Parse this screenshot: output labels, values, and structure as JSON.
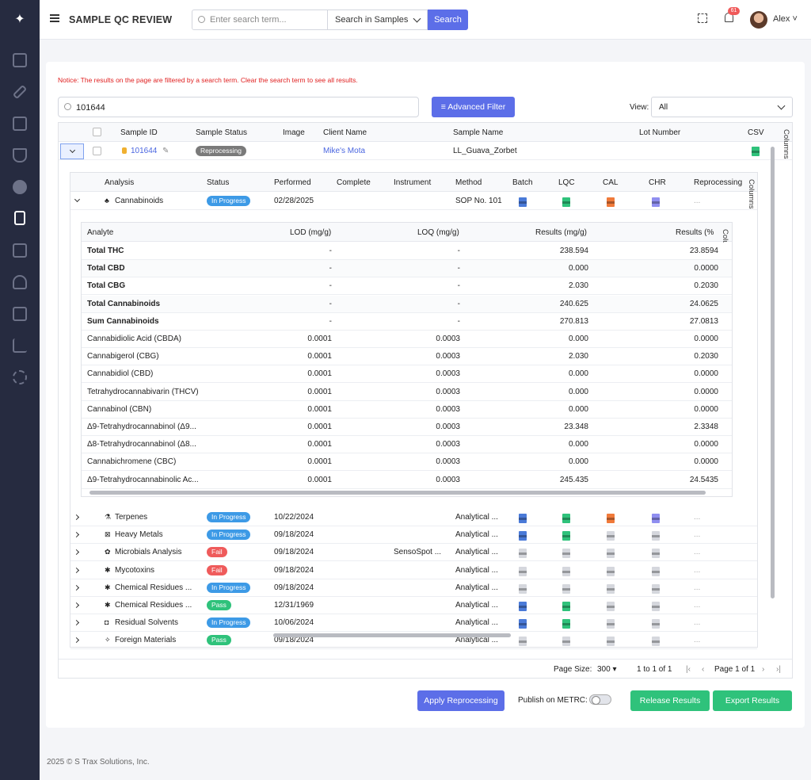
{
  "app": {
    "title": "SAMPLE QC REVIEW",
    "user": "Alex",
    "notifications": "61"
  },
  "topsearch": {
    "placeholder": "Enter search term...",
    "scope": "Search in Samples",
    "button": "Search"
  },
  "notice": "Notice: The results on the page are filtered by a search term. Clear the search term to see all results.",
  "filter": {
    "search_value": "101644",
    "advanced": "Advanced Filter",
    "view_label": "View:",
    "view_value": "All"
  },
  "main_cols": [
    "Sample ID",
    "Sample Status",
    "Image",
    "Client Name",
    "Sample Name",
    "Lot Number",
    "CSV"
  ],
  "sample": {
    "id": "101644",
    "status": "Reprocessing",
    "client": "Mike's Mota",
    "name": "LL_Guava_Zorbet"
  },
  "columns_label": "Columns",
  "analysis_cols": [
    "Analysis",
    "Status",
    "Performed",
    "Complete",
    "Instrument",
    "Method",
    "Batch",
    "LQC",
    "CAL",
    "CHR",
    "Reprocessing"
  ],
  "cannabinoids": {
    "name": "Cannabinoids",
    "status": "In Progress",
    "performed": "02/28/2025",
    "method": "SOP No. 101",
    "reprocessing": "..."
  },
  "analyte_cols": [
    "Analyte",
    "LOD (mg/g)",
    "LOQ (mg/g)",
    "Results (mg/g)",
    "Results (%"
  ],
  "analytes": [
    {
      "name": "Total THC",
      "lod": "-",
      "loq": "-",
      "res": "238.594",
      "pct": "23.8594",
      "bold": true
    },
    {
      "name": "Total CBD",
      "lod": "-",
      "loq": "-",
      "res": "0.000",
      "pct": "0.0000",
      "bold": true
    },
    {
      "name": "Total CBG",
      "lod": "-",
      "loq": "-",
      "res": "2.030",
      "pct": "0.2030",
      "bold": true
    },
    {
      "name": "Total Cannabinoids",
      "lod": "-",
      "loq": "-",
      "res": "240.625",
      "pct": "24.0625",
      "bold": true
    },
    {
      "name": "Sum Cannabinoids",
      "lod": "-",
      "loq": "-",
      "res": "270.813",
      "pct": "27.0813",
      "bold": true
    },
    {
      "name": "Cannabidiolic Acid (CBDA)",
      "lod": "0.0001",
      "loq": "0.0003",
      "res": "0.000",
      "pct": "0.0000",
      "bold": false
    },
    {
      "name": "Cannabigerol (CBG)",
      "lod": "0.0001",
      "loq": "0.0003",
      "res": "2.030",
      "pct": "0.2030",
      "bold": false
    },
    {
      "name": "Cannabidiol (CBD)",
      "lod": "0.0001",
      "loq": "0.0003",
      "res": "0.000",
      "pct": "0.0000",
      "bold": false
    },
    {
      "name": "Tetrahydrocannabivarin (THCV)",
      "lod": "0.0001",
      "loq": "0.0003",
      "res": "0.000",
      "pct": "0.0000",
      "bold": false
    },
    {
      "name": "Cannabinol (CBN)",
      "lod": "0.0001",
      "loq": "0.0003",
      "res": "0.000",
      "pct": "0.0000",
      "bold": false
    },
    {
      "name": "Δ9-Tetrahydrocannabinol (Δ9...",
      "lod": "0.0001",
      "loq": "0.0003",
      "res": "23.348",
      "pct": "2.3348",
      "bold": false
    },
    {
      "name": "Δ8-Tetrahydrocannabinol (Δ8...",
      "lod": "0.0001",
      "loq": "0.0003",
      "res": "0.000",
      "pct": "0.0000",
      "bold": false
    },
    {
      "name": "Cannabichromene (CBC)",
      "lod": "0.0001",
      "loq": "0.0003",
      "res": "0.000",
      "pct": "0.0000",
      "bold": false
    },
    {
      "name": "Δ9-Tetrahydrocannabinolic Ac...",
      "lod": "0.0001",
      "loq": "0.0003",
      "res": "245.435",
      "pct": "24.5435",
      "bold": false
    }
  ],
  "analyses": [
    {
      "name": "Terpenes",
      "status": "In Progress",
      "color": "blue",
      "performed": "10/22/2024",
      "instrument": "",
      "method": "Analytical ...",
      "reprocessing": "..."
    },
    {
      "name": "Heavy Metals",
      "status": "In Progress",
      "color": "blue",
      "performed": "09/18/2024",
      "instrument": "",
      "method": "Analytical ...",
      "reprocessing": "..."
    },
    {
      "name": "Microbials Analysis",
      "status": "Fail",
      "color": "red",
      "performed": "09/18/2024",
      "instrument": "SensoSpot ...",
      "method": "Analytical ...",
      "reprocessing": "..."
    },
    {
      "name": "Mycotoxins",
      "status": "Fail",
      "color": "red",
      "performed": "09/18/2024",
      "instrument": "",
      "method": "Analytical ...",
      "reprocessing": "..."
    },
    {
      "name": "Chemical Residues ...",
      "status": "In Progress",
      "color": "blue",
      "performed": "09/18/2024",
      "instrument": "",
      "method": "Analytical ...",
      "reprocessing": "..."
    },
    {
      "name": "Chemical Residues ...",
      "status": "Pass",
      "color": "green",
      "performed": "12/31/1969",
      "instrument": "",
      "method": "Analytical ...",
      "reprocessing": "..."
    },
    {
      "name": "Residual Solvents",
      "status": "In Progress",
      "color": "blue",
      "performed": "10/06/2024",
      "instrument": "",
      "method": "Analytical ...",
      "reprocessing": "..."
    },
    {
      "name": "Foreign Materials",
      "status": "Pass",
      "color": "green",
      "performed": "09/18/2024",
      "instrument": "",
      "method": "Analytical ...",
      "reprocessing": "..."
    }
  ],
  "pager": {
    "page_size_label": "Page Size:",
    "page_size": "300",
    "range": "1 to 1 of 1",
    "page": "Page 1 of 1"
  },
  "actions": {
    "apply": "Apply Reprocessing",
    "publish_label": "Publish on METRC:",
    "release": "Release Results",
    "export": "Export Results"
  },
  "footer": "2025 © S Trax Solutions, Inc.",
  "colors": {
    "accent": "#5c6ee8",
    "green": "#2fc27b",
    "sidebar": "#262b40"
  }
}
